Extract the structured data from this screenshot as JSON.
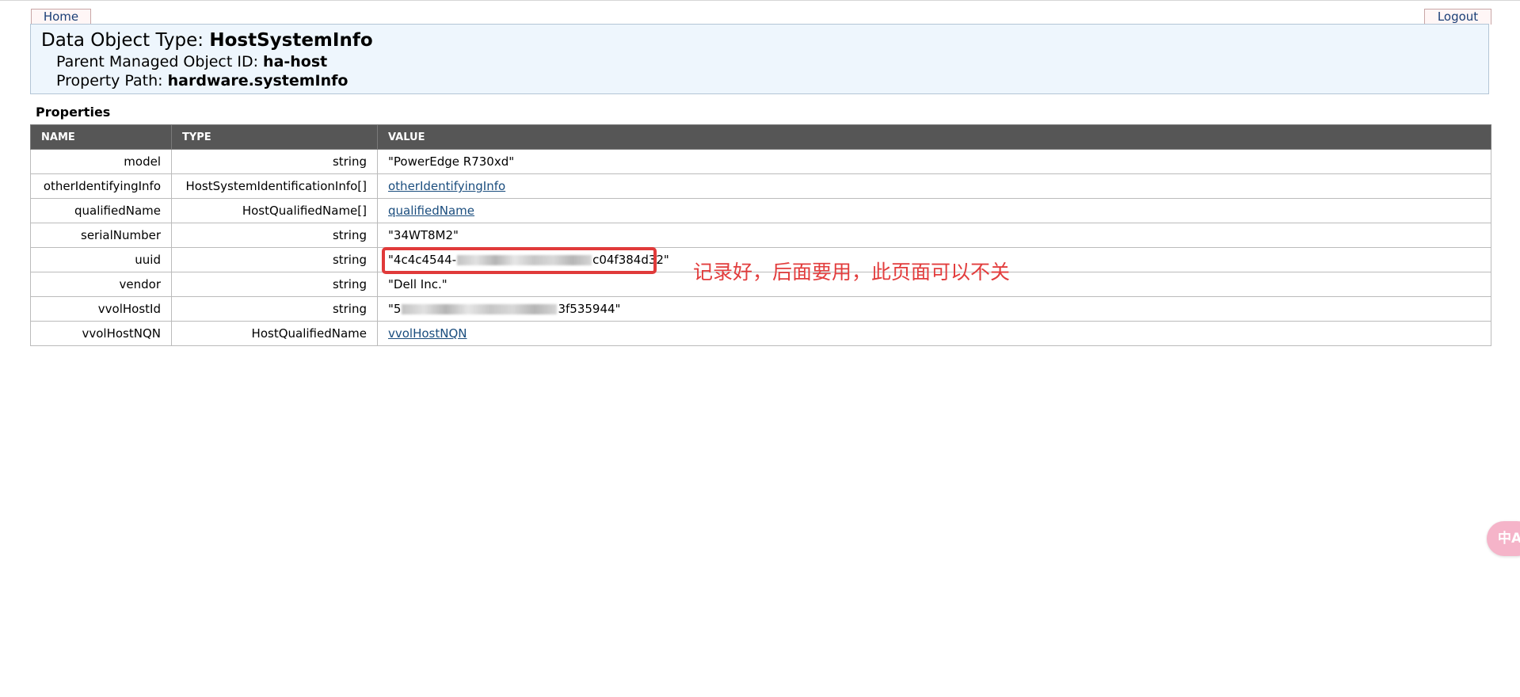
{
  "nav": {
    "home_label": "Home",
    "logout_label": "Logout"
  },
  "header": {
    "type_label": "Data Object Type:",
    "type_value": "HostSystemInfo",
    "parent_label": "Parent Managed Object ID:",
    "parent_value": "ha-host",
    "path_label": "Property Path:",
    "path_value": "hardware.systemInfo"
  },
  "properties": {
    "title": "Properties",
    "columns": [
      "NAME",
      "TYPE",
      "VALUE"
    ],
    "rows": [
      {
        "name": "model",
        "type": "string",
        "value": "\"PowerEdge R730xd\""
      },
      {
        "name": "otherIdentifyingInfo",
        "type": "HostSystemIdentificationInfo[]",
        "value": "otherIdentifyingInfo"
      },
      {
        "name": "qualifiedName",
        "type": "HostQualifiedName[]",
        "value": "qualifiedName"
      },
      {
        "name": "serialNumber",
        "type": "string",
        "value": "\"34WT8M2\""
      },
      {
        "name": "uuid",
        "type": "string",
        "value_prefix": "\"4c4c4544-",
        "value_suffix": "c04f384d32\""
      },
      {
        "name": "vendor",
        "type": "string",
        "value": "\"Dell Inc.\""
      },
      {
        "name": "vvolHostId",
        "type": "string",
        "value_prefix": "\"5",
        "value_suffix": "3f535944\""
      },
      {
        "name": "vvolHostNQN",
        "type": "HostQualifiedName",
        "value": "vvolHostNQN"
      }
    ]
  },
  "annotation": {
    "text": "记录好，后面要用，此页面可以不关",
    "color": "#e23d3d"
  },
  "floating_button": {
    "label": "中A",
    "icon": "translate-icon"
  },
  "colors": {
    "header_bg": "#eef6fd",
    "table_header_bg": "#565656",
    "link": "#1a4d7e",
    "highlight": "#e03a3a"
  }
}
